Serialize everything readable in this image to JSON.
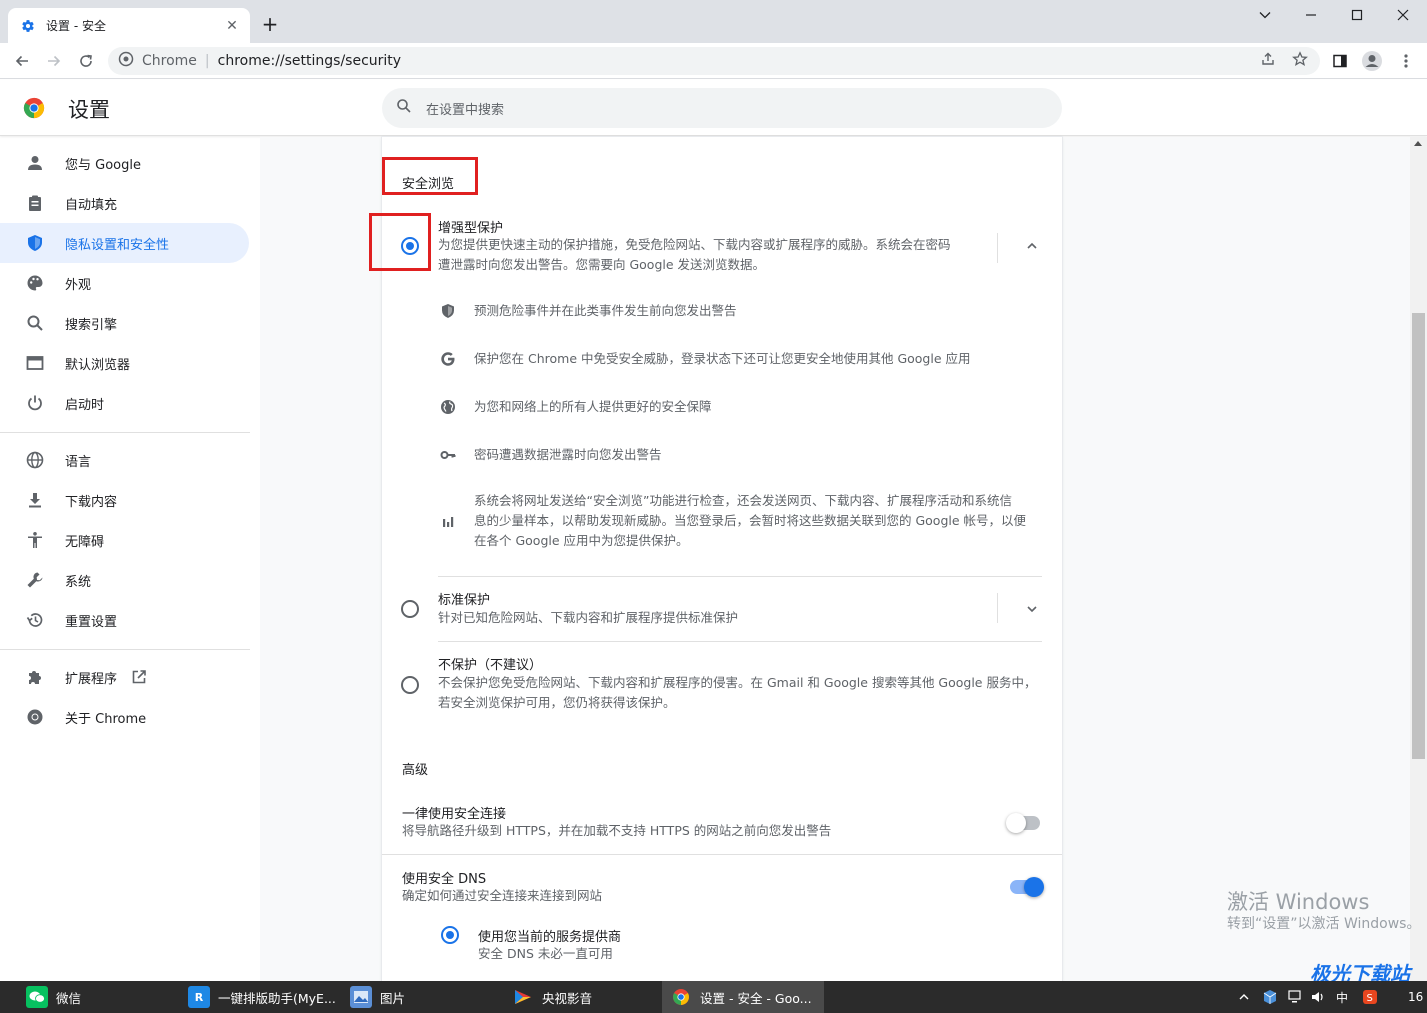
{
  "browser": {
    "tab_title": "设置 - 安全",
    "new_tab": "+",
    "site_label": "Chrome",
    "url": "chrome://settings/security"
  },
  "header": {
    "title": "设置",
    "search_placeholder": "在设置中搜索"
  },
  "sidebar": {
    "items": [
      {
        "label": "您与 Google",
        "icon": "person-icon"
      },
      {
        "label": "自动填充",
        "icon": "clipboard-icon"
      },
      {
        "label": "隐私设置和安全性",
        "icon": "shield-icon",
        "active": true
      },
      {
        "label": "外观",
        "icon": "palette-icon"
      },
      {
        "label": "搜索引擎",
        "icon": "search-icon"
      },
      {
        "label": "默认浏览器",
        "icon": "browser-icon"
      },
      {
        "label": "启动时",
        "icon": "power-icon"
      },
      {
        "label": "语言",
        "icon": "globe-icon"
      },
      {
        "label": "下载内容",
        "icon": "download-icon"
      },
      {
        "label": "无障碍",
        "icon": "accessibility-icon"
      },
      {
        "label": "系统",
        "icon": "wrench-icon"
      },
      {
        "label": "重置设置",
        "icon": "history-icon"
      },
      {
        "label": "扩展程序",
        "icon": "puzzle-icon"
      },
      {
        "label": "关于 Chrome",
        "icon": "chrome-icon"
      }
    ]
  },
  "main": {
    "section_title": "安全浏览",
    "enhanced": {
      "title": "增强型保护",
      "desc_line1": "为您提供更快速主动的保护措施，免受危险网站、下载内容或扩展程序的威胁。系统会在密码",
      "desc_line2": "遭泄露时向您发出警告。您需要向 Google 发送浏览数据。",
      "selected": true
    },
    "features": [
      {
        "icon": "shield-icon",
        "text": "预测危险事件并在此类事件发生前向您发出警告"
      },
      {
        "icon": "google-g-icon",
        "text": "保护您在 Chrome 中免受安全威胁，登录状态下还可让您更安全地使用其他 Google 应用"
      },
      {
        "icon": "globe-icon",
        "text": "为您和网络上的所有人提供更好的安全保障"
      },
      {
        "icon": "key-icon",
        "text": "密码遭遇数据泄露时向您发出警告"
      }
    ],
    "feature_data": {
      "line1": "系统会将网址发送给“安全浏览”功能进行检查，还会发送网页、下载内容、扩展程序活动和系统信",
      "line2": "息的少量样本，以帮助发现新威胁。当您登录后，会暂时将这些数据关联到您的 Google 帐号，以便",
      "line3": "在各个 Google 应用中为您提供保护。"
    },
    "standard": {
      "title": "标准保护",
      "desc": "针对已知危险网站、下载内容和扩展程序提供标准保护"
    },
    "no_protection": {
      "title": "不保护（不建议）",
      "desc_line1": "不会保护您免受危险网站、下载内容和扩展程序的侵害。在 Gmail 和 Google 搜索等其他 Google 服务中，",
      "desc_line2": "若安全浏览保护可用，您仍将获得该保护。"
    },
    "advanced_title": "高级",
    "https": {
      "title": "一律使用安全连接",
      "desc": "将导航路径升级到 HTTPS，并在加载不支持 HTTPS 的网站之前向您发出警告",
      "enabled": false
    },
    "dns": {
      "title": "使用安全 DNS",
      "desc": "确定如何通过安全连接来连接到网站",
      "enabled": true,
      "option_title": "使用您当前的服务提供商",
      "option_desc": "安全 DNS 未必一直可用"
    }
  },
  "watermark": {
    "line1": "激活 Windows",
    "line2": "转到“设置”以激活 Windows。"
  },
  "brand_watermark": "极光下载站",
  "taskbar": {
    "items": [
      {
        "label": "微信",
        "icon": "wechat-icon"
      },
      {
        "label": "一键排版助手(MyE...",
        "icon": "r-app-icon"
      },
      {
        "label": "图片",
        "icon": "photos-icon"
      },
      {
        "label": "央视影音",
        "icon": "cctv-icon"
      },
      {
        "label": "设置 - 安全 - Goo...",
        "icon": "chrome-icon",
        "active": true
      }
    ],
    "ime": "中",
    "clock": "16"
  },
  "colors": {
    "accent": "#1a73e8",
    "highlight_box": "#e02020",
    "active_nav_bg": "#e8f0fe"
  }
}
